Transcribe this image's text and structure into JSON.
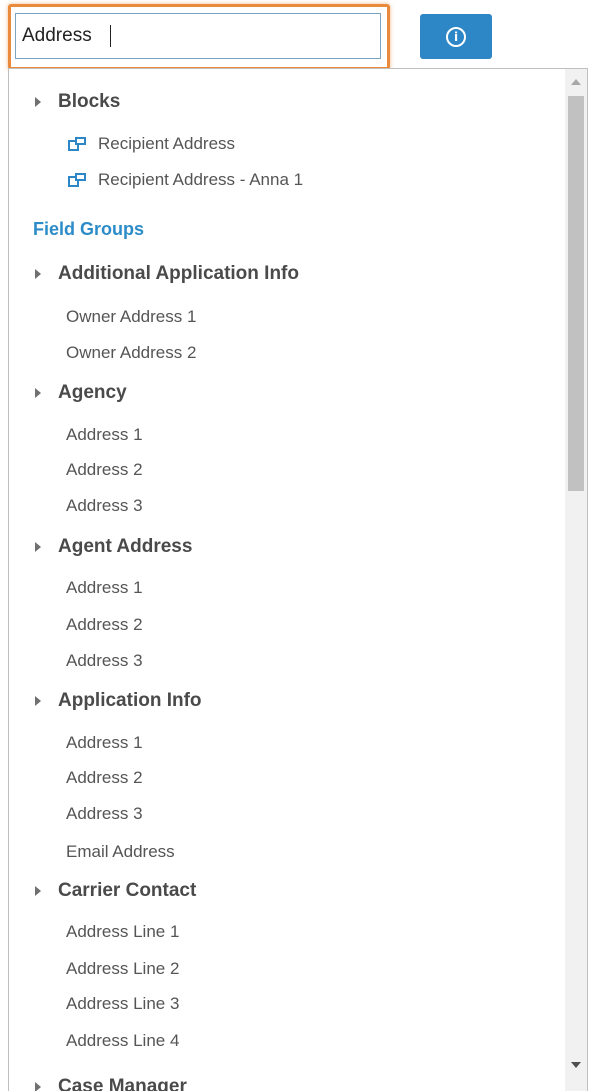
{
  "search": {
    "value": "Address"
  },
  "info_button": {
    "icon": "info-icon",
    "glyph": "i"
  },
  "blocks": {
    "title": "Blocks",
    "items": [
      "Recipient Address",
      "Recipient Address - Anna 1"
    ]
  },
  "field_groups_title": "Field Groups",
  "groups": [
    {
      "title": "Additional Application Info",
      "items": [
        "Owner Address 1",
        "Owner Address 2"
      ]
    },
    {
      "title": "Agency",
      "items": [
        "Address 1",
        "Address 2",
        "Address 3"
      ]
    },
    {
      "title": "Agent Address",
      "items": [
        "Address 1",
        "Address 2",
        "Address 3"
      ]
    },
    {
      "title": "Application Info",
      "items": [
        "Address 1",
        "Address 2",
        "Address 3",
        "Email Address"
      ]
    },
    {
      "title": "Carrier Contact",
      "items": [
        "Address Line 1",
        "Address Line 2",
        "Address Line 3",
        "Address Line 4"
      ]
    },
    {
      "title": "Case Manager",
      "items": []
    }
  ],
  "colors": {
    "accent": "#2d86c6",
    "focus_border": "#e98a3c",
    "section_title": "#2d8cc8"
  }
}
